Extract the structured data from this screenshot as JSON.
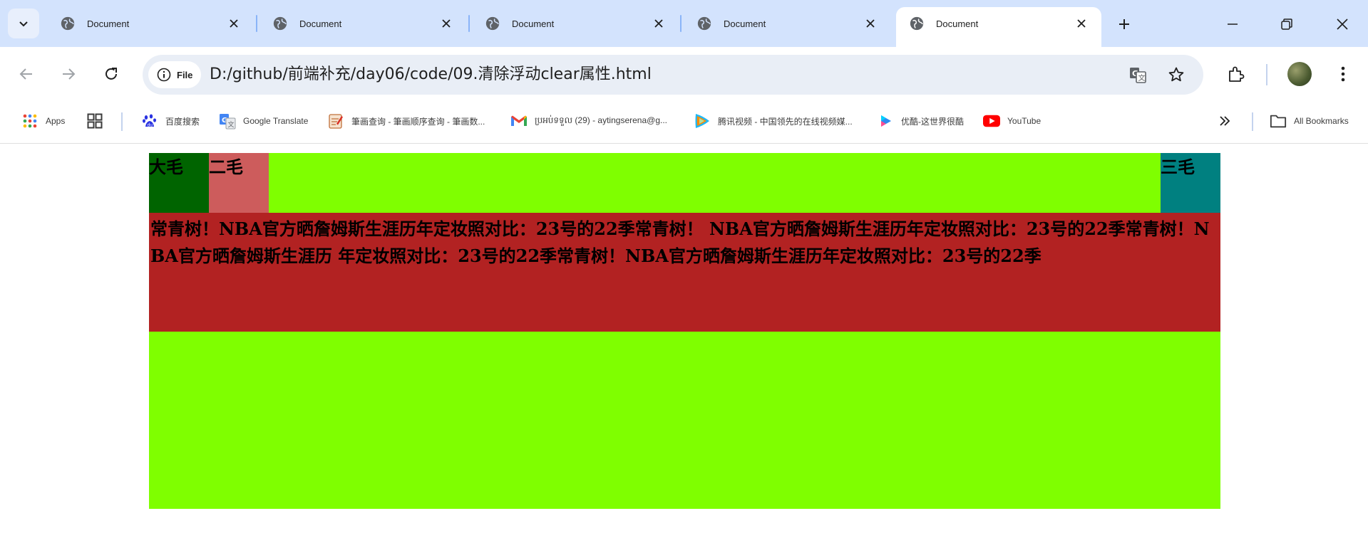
{
  "tabs": [
    {
      "title": "Document",
      "active": false
    },
    {
      "title": "Document",
      "active": false
    },
    {
      "title": "Document",
      "active": false
    },
    {
      "title": "Document",
      "active": false
    },
    {
      "title": "Document",
      "active": true
    }
  ],
  "toolbar": {
    "chip_label": "File",
    "url": "D:/github/前端补充/day06/code/09.清除浮动clear属性.html"
  },
  "bookmarks": {
    "items": [
      {
        "label": "Apps",
        "icon": "apps-grid-icon"
      },
      {
        "label": "",
        "icon": "tab-groups-icon"
      },
      {
        "label": "百度搜索",
        "icon": "baidu-icon"
      },
      {
        "label": "Google Translate",
        "icon": "google-translate-icon"
      },
      {
        "label": "筆画查询 - 筆画顺序查询 - 筆画数...",
        "icon": "notepad-icon"
      },
      {
        "label": "ប្រអប់ទទួល (29) - aytingserena@g...",
        "icon": "gmail-icon"
      },
      {
        "label": "腾讯视频 - 中国领先的在线视频媒...",
        "icon": "tencent-video-icon"
      },
      {
        "label": "优酷-这世界很酷",
        "icon": "youku-icon"
      },
      {
        "label": "YouTube",
        "icon": "youtube-icon"
      }
    ],
    "all_bookmarks": "All Bookmarks"
  },
  "content": {
    "box1": "大毛",
    "box2": "二毛",
    "box3": "三毛",
    "paragraph": "常青树！NBA官方晒詹姆斯生涯历年定妆照对比：23号的22季常青树！ NBA官方晒詹姆斯生涯历年定妆照对比：23号的22季常青树！NBA官方晒詹姆斯生涯历 年定妆照对比：23号的22季常青树！NBA官方晒詹姆斯生涯历年定妆照对比：23号的22季"
  },
  "colors": {
    "outer": "#7fff00",
    "box1": "#006400",
    "box2": "#cd5c5c",
    "box3": "#008080",
    "paragraph_bg": "#b22222"
  }
}
